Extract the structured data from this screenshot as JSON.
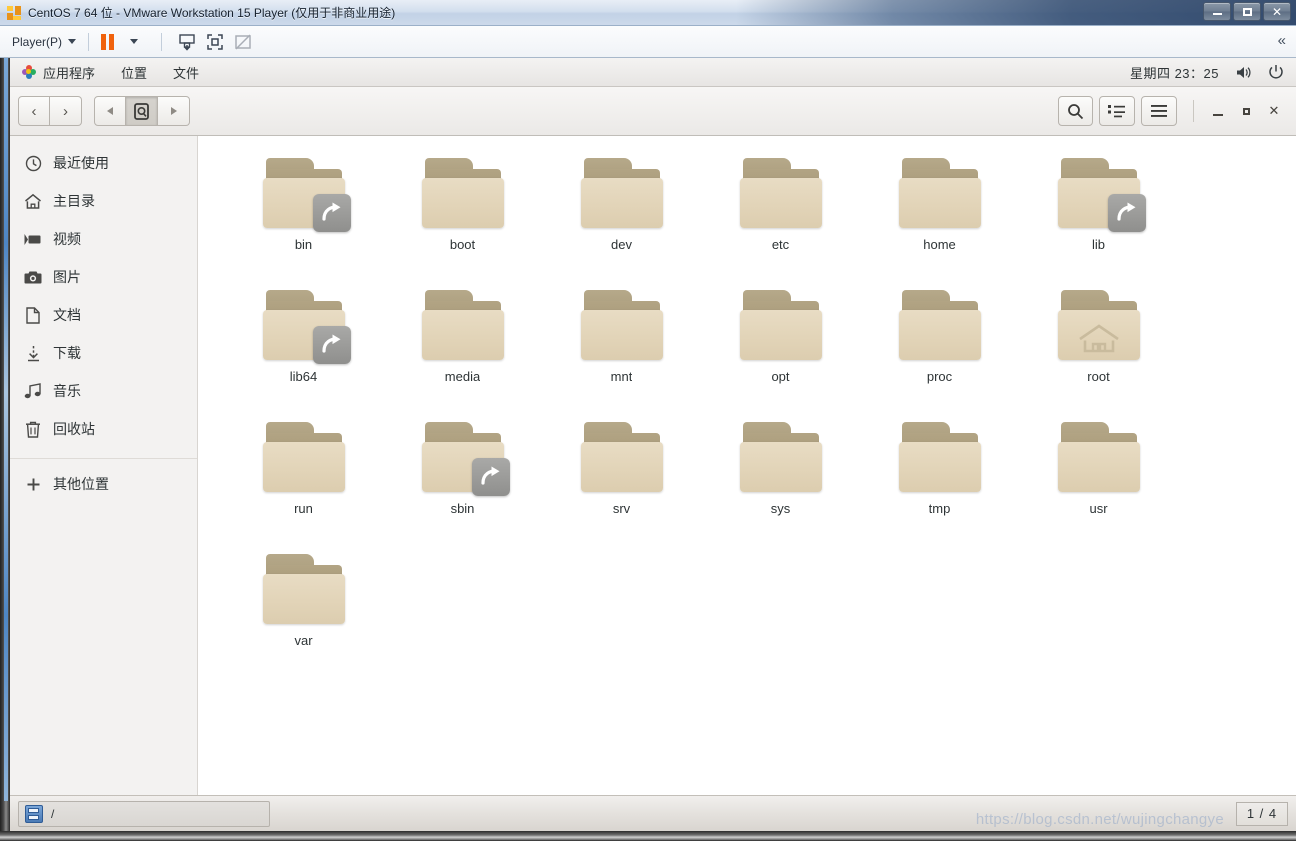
{
  "vmware": {
    "title": "CentOS 7 64 位 - VMware Workstation 15 Player (仅用于非商业用途)",
    "title_icon": "vmware-logo-icon",
    "window_controls": {
      "minimize": "minimize-icon",
      "maximize": "maximize-icon",
      "close": "close-icon"
    },
    "toolbar": {
      "player_menu_label": "Player(P)",
      "pause_icon": "pause-icon",
      "pause_dropdown_icon": "chevron-down-icon",
      "send_key_icon": "send-ctrl-alt-del-icon",
      "fullscreen_icon": "enter-fullscreen-icon",
      "unity_icon": "unity-mode-disabled-icon",
      "collapse_icon": "collapse-toolbar-icon",
      "collapse_glyph": "«"
    }
  },
  "gnome_panel": {
    "menus": [
      {
        "label": "应用程序",
        "name": "applications-menu",
        "icon": "gnome-apps-icon"
      },
      {
        "label": "位置",
        "name": "places-menu"
      },
      {
        "label": "文件",
        "name": "files-menu"
      }
    ],
    "clock": "星期四 23：25",
    "volume_icon": "volume-icon",
    "power_icon": "power-icon"
  },
  "nautilus": {
    "header": {
      "back_icon": "back-chevron-icon",
      "forward_icon": "forward-chevron-icon",
      "pathbar_prev_icon": "pathbar-scroll-left-icon",
      "pathbar_root_icon": "filesystem-root-icon",
      "pathbar_next_icon": "pathbar-scroll-right-icon",
      "search_icon": "search-icon",
      "view_list_icon": "list-view-icon",
      "menu_icon": "hamburger-menu-icon",
      "minimize_icon": "minimize-icon",
      "maximize_icon": "maximize-icon",
      "close_icon": "close-icon"
    },
    "sidebar": {
      "items": [
        {
          "label": "最近使用",
          "icon": "clock-icon",
          "name": "sidebar-item-recent"
        },
        {
          "label": "主目录",
          "icon": "home-icon",
          "name": "sidebar-item-home"
        },
        {
          "label": "视频",
          "icon": "video-icon",
          "name": "sidebar-item-videos"
        },
        {
          "label": "图片",
          "icon": "camera-icon",
          "name": "sidebar-item-pictures"
        },
        {
          "label": "文档",
          "icon": "document-icon",
          "name": "sidebar-item-documents"
        },
        {
          "label": "下载",
          "icon": "download-icon",
          "name": "sidebar-item-downloads"
        },
        {
          "label": "音乐",
          "icon": "music-note-icon",
          "name": "sidebar-item-music"
        },
        {
          "label": "回收站",
          "icon": "trash-icon",
          "name": "sidebar-item-trash"
        }
      ],
      "other_locations": {
        "label": "其他位置",
        "icon": "plus-icon",
        "name": "sidebar-item-other-locations"
      }
    },
    "files": [
      {
        "label": "bin",
        "emblem": "symlink"
      },
      {
        "label": "boot",
        "emblem": "none"
      },
      {
        "label": "dev",
        "emblem": "none"
      },
      {
        "label": "etc",
        "emblem": "none"
      },
      {
        "label": "home",
        "emblem": "none"
      },
      {
        "label": "lib",
        "emblem": "symlink"
      },
      {
        "label": "lib64",
        "emblem": "symlink"
      },
      {
        "label": "media",
        "emblem": "none"
      },
      {
        "label": "mnt",
        "emblem": "none"
      },
      {
        "label": "opt",
        "emblem": "none"
      },
      {
        "label": "proc",
        "emblem": "none"
      },
      {
        "label": "root",
        "emblem": "home"
      },
      {
        "label": "run",
        "emblem": "none"
      },
      {
        "label": "sbin",
        "emblem": "symlink"
      },
      {
        "label": "srv",
        "emblem": "none"
      },
      {
        "label": "sys",
        "emblem": "none"
      },
      {
        "label": "tmp",
        "emblem": "none"
      },
      {
        "label": "usr",
        "emblem": "none"
      },
      {
        "label": "var",
        "emblem": "none"
      }
    ]
  },
  "guest_taskbar": {
    "task_label": "/",
    "task_icon": "file-manager-icon",
    "watermark": "https://blog.csdn.net/wujingchangye",
    "workspace": "1 / 4"
  },
  "colors": {
    "accent_orange": "#f0620d",
    "folder_front": "#e2d4b8",
    "folder_back": "#ab9d7d",
    "emblem_gray": "#9a9a98",
    "panel_bg": "#efedeb"
  }
}
